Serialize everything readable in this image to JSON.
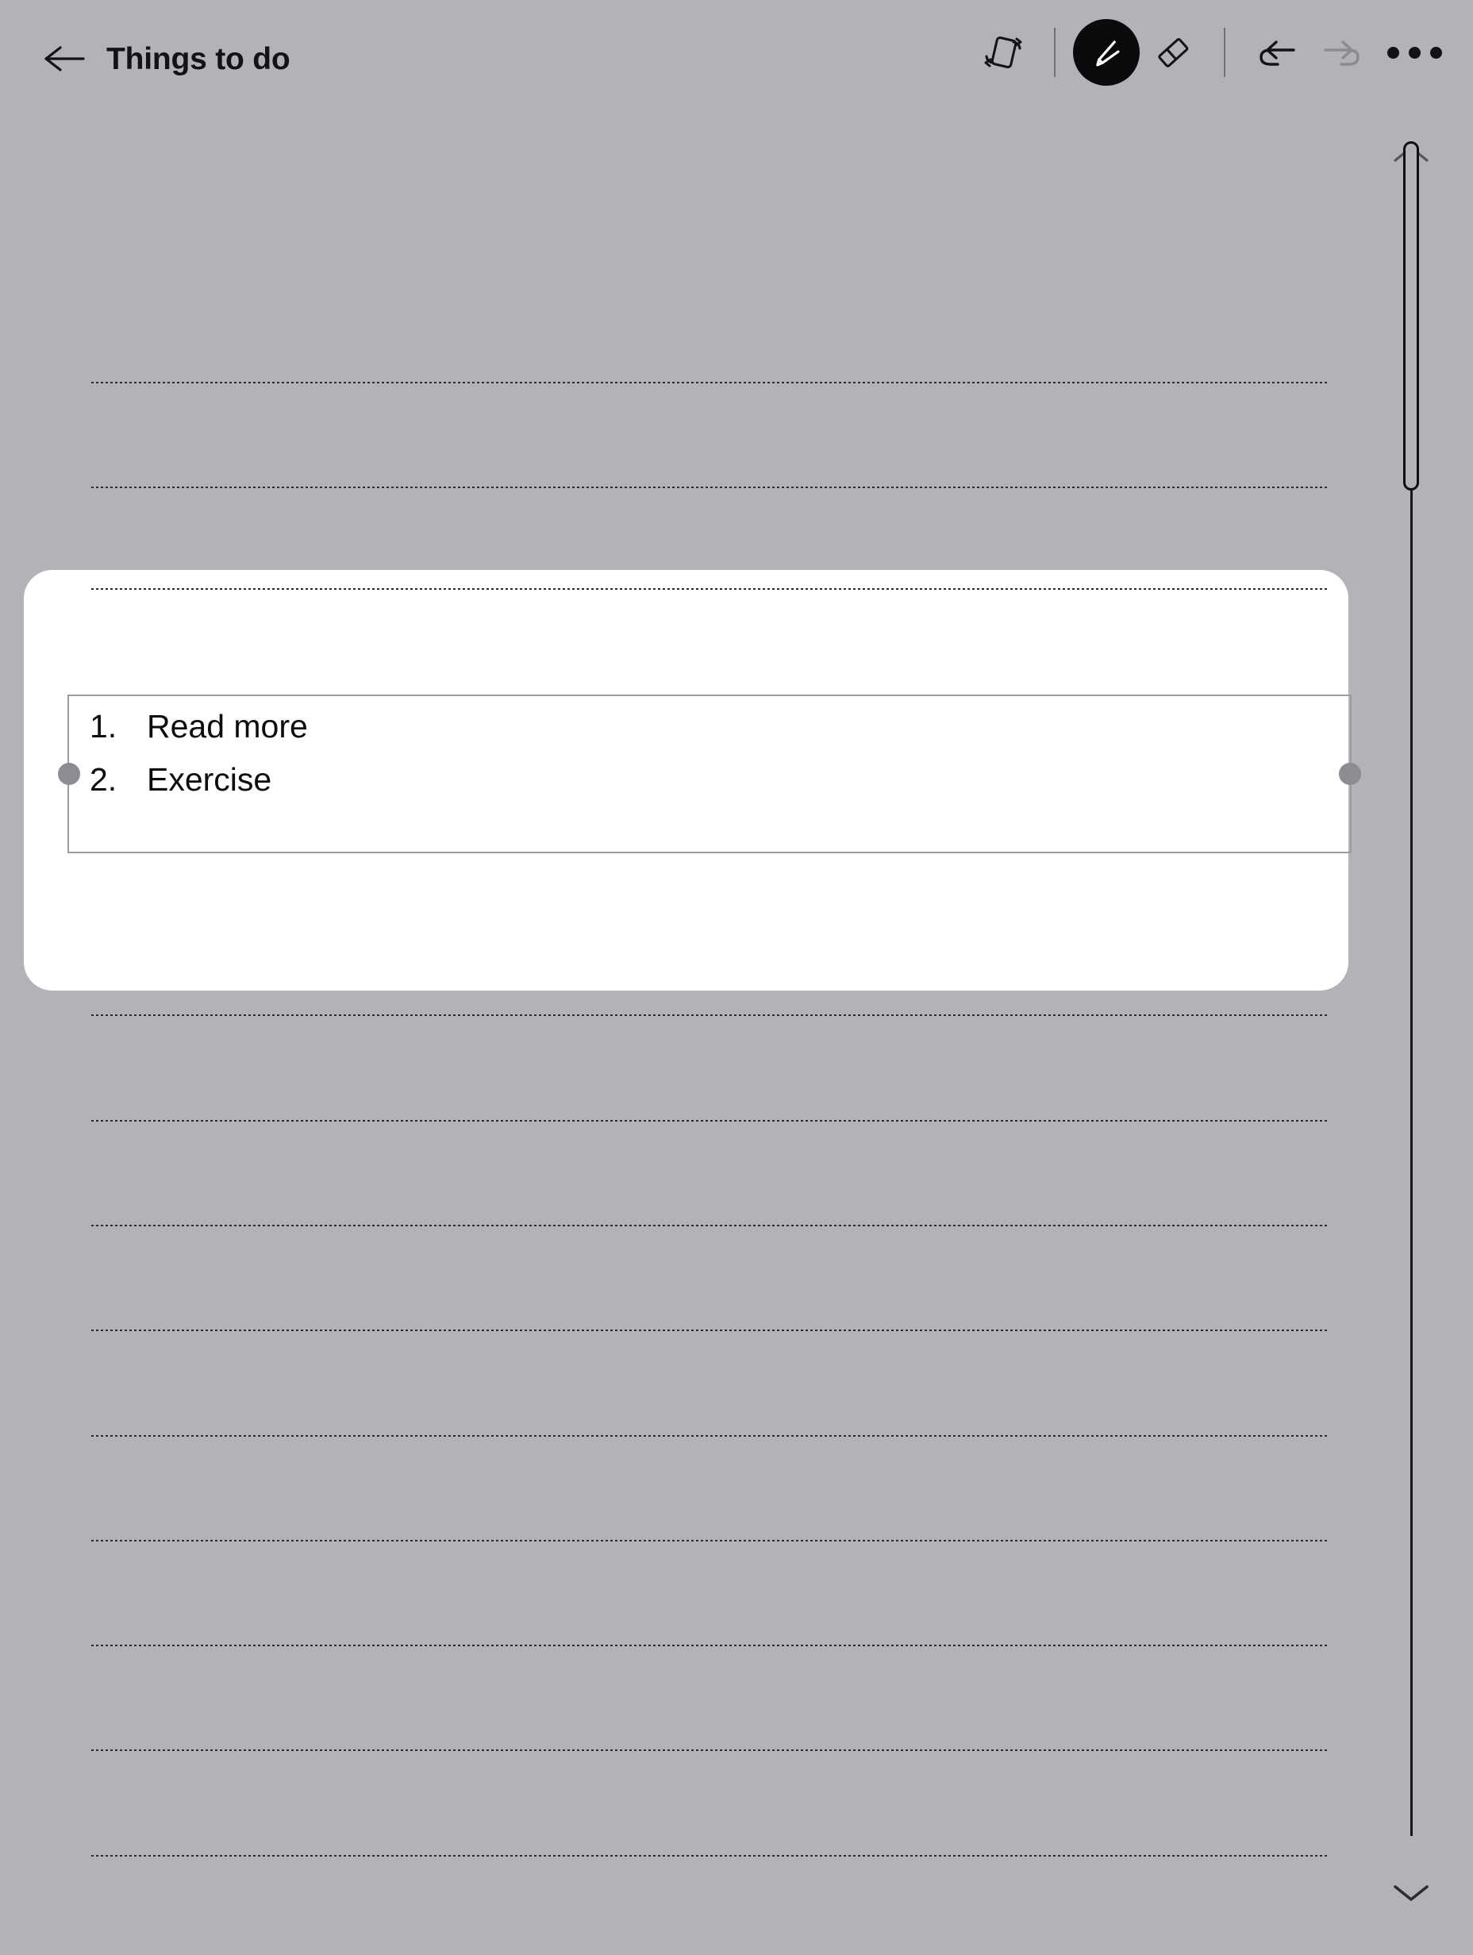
{
  "app": {
    "background_color": "#b1b3b7",
    "card_color": "#ffffff",
    "ink_color": "#0b0c0e"
  },
  "topbar": {
    "back_icon": "back-arrow-icon",
    "title": "Things to do",
    "tools": [
      {
        "name": "rotate-page-icon",
        "label": "Rotate",
        "active": false
      },
      {
        "name": "pen-icon",
        "label": "Pen",
        "active": true
      },
      {
        "name": "eraser-icon",
        "label": "Eraser",
        "active": false
      }
    ],
    "undo": {
      "name": "undo-icon",
      "label": "Undo",
      "enabled": true,
      "color": "#111315"
    },
    "redo": {
      "name": "redo-icon",
      "label": "Redo",
      "enabled": false,
      "color": "#8a8c90"
    },
    "more": {
      "name": "more-options-icon",
      "label": "More options"
    }
  },
  "page": {
    "rule_line_tops": [
      330,
      462,
      594,
      1127,
      1260,
      1392,
      1524,
      1657,
      1789,
      1921,
      2053,
      2186
    ],
    "card_rule_tops": [
      22
    ]
  },
  "selection": {
    "handle_color": "#8b8d92",
    "border_color": "#9b9da1",
    "items": [
      {
        "number": "1.",
        "text": "Read more"
      },
      {
        "number": "2.",
        "text": "Exercise"
      }
    ],
    "left_handle": "selection-handle-left",
    "right_handle": "selection-handle-right"
  },
  "scrollbar": {
    "up_icon": "chevron-up-icon",
    "down_icon": "chevron-down-icon",
    "thumb": "scroll-thumb",
    "track": "scroll-track"
  }
}
